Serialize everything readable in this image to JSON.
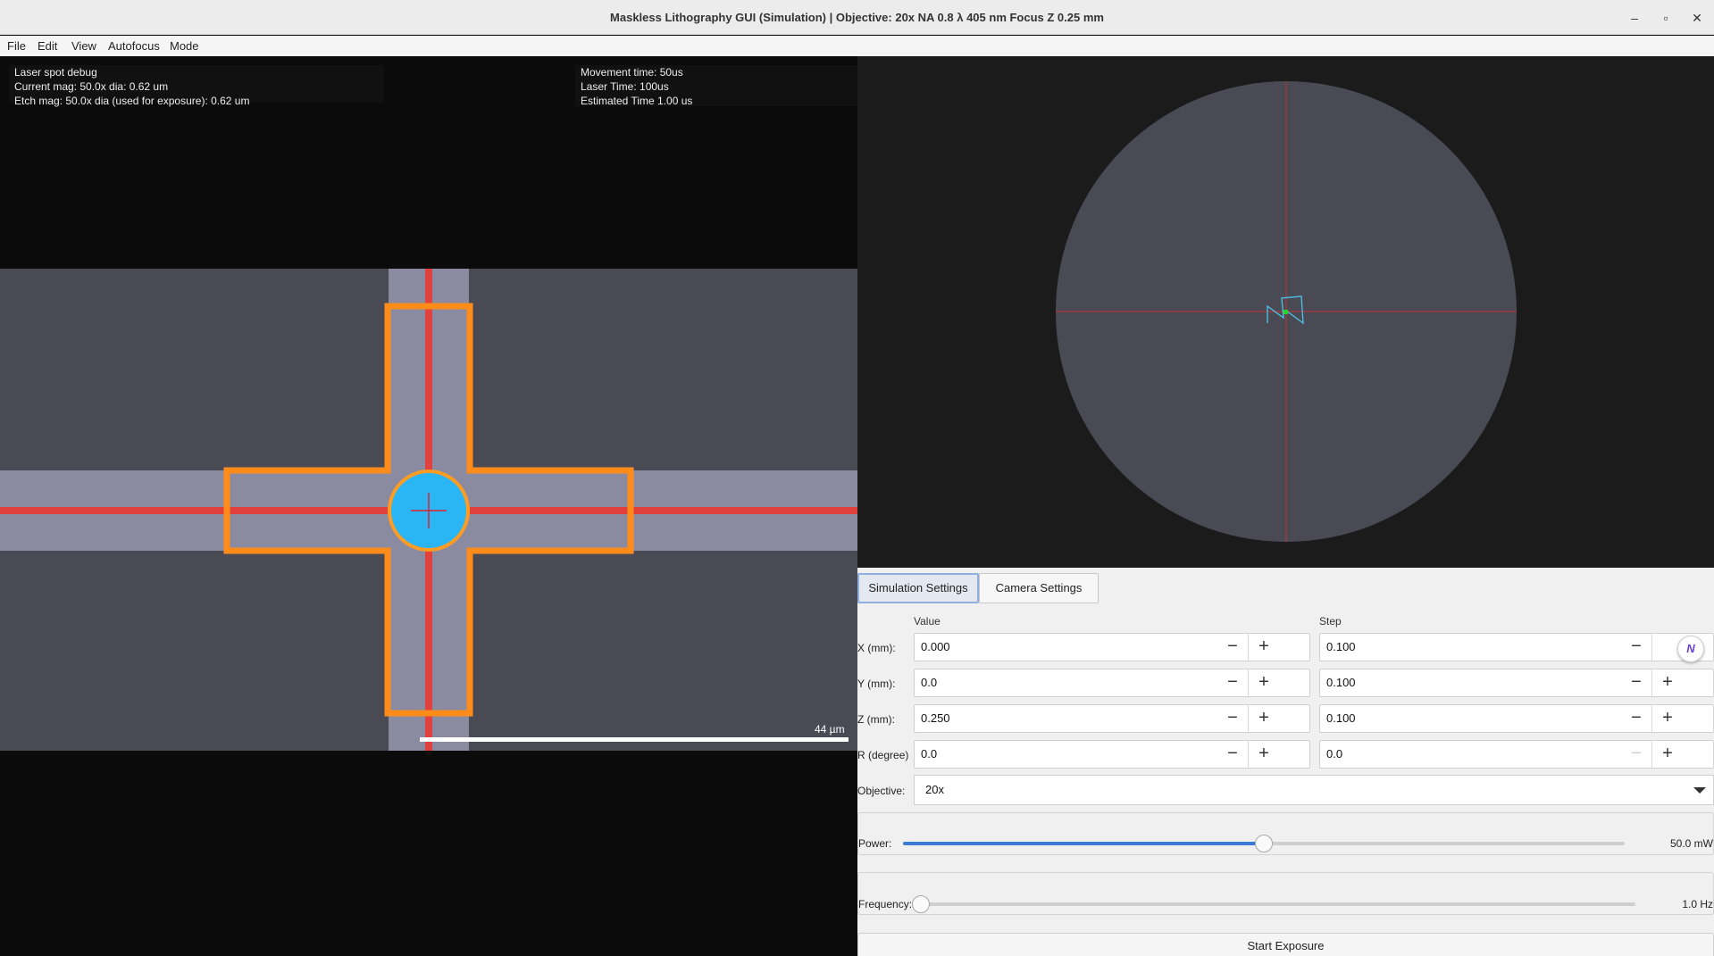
{
  "window": {
    "title": "Maskless Lithography GUI (Simulation)  |  Objective: 20x  NA 0.8  λ 405 nm  Focus Z 0.25 mm",
    "minimize_glyph": "–",
    "maximize_glyph": "▫",
    "close_glyph": "✕"
  },
  "menu": [
    "File",
    "Edit",
    "View",
    "Autofocus",
    "Mode"
  ],
  "laser_debug": {
    "line1": "Laser spot debug",
    "line2": "Current mag: 50.0x  dia: 0.62 um",
    "line3": "Etch mag: 50.0x  dia (used for exposure): 0.62 um"
  },
  "timing": {
    "line1": "Movement time: 50us",
    "line2": "Laser Time: 100us",
    "line3": "Estimated Time 1.00 us"
  },
  "scale_bar": {
    "label": "44 µm"
  },
  "colors": {
    "substrate": "#4a4a55",
    "pattern": "#8a8aa0",
    "outline": "#ff8c1a",
    "etch_line": "#e0413e",
    "laser_spot": "#2ab6f5",
    "camera_circle": "#4a4a55"
  },
  "tabs": [
    "Simulation Settings",
    "Camera Settings"
  ],
  "active_tab": "Simulation Settings",
  "columns": {
    "value": "Value",
    "step": "Step"
  },
  "axes": [
    {
      "label": "X (mm):",
      "value": "0.000",
      "step": "0.100"
    },
    {
      "label": "Y (mm):",
      "value": "0.0",
      "step": "0.100"
    },
    {
      "label": "Z (mm):",
      "value": "0.250",
      "step": "0.100"
    },
    {
      "label": "R (degree)",
      "value": "0.0",
      "step": "0.0"
    }
  ],
  "stepper": {
    "minus": "−",
    "plus": "+"
  },
  "objective": {
    "label": "Objective:",
    "selected": "20x"
  },
  "power": {
    "label": "Power:",
    "value_text": "50.0 mW",
    "fraction": 0.5
  },
  "frequency": {
    "label": "Frequency:",
    "value_text": "1.0 Hz",
    "fraction": 0.0
  },
  "start_button": "Start Exposure",
  "floating_badge": "N"
}
